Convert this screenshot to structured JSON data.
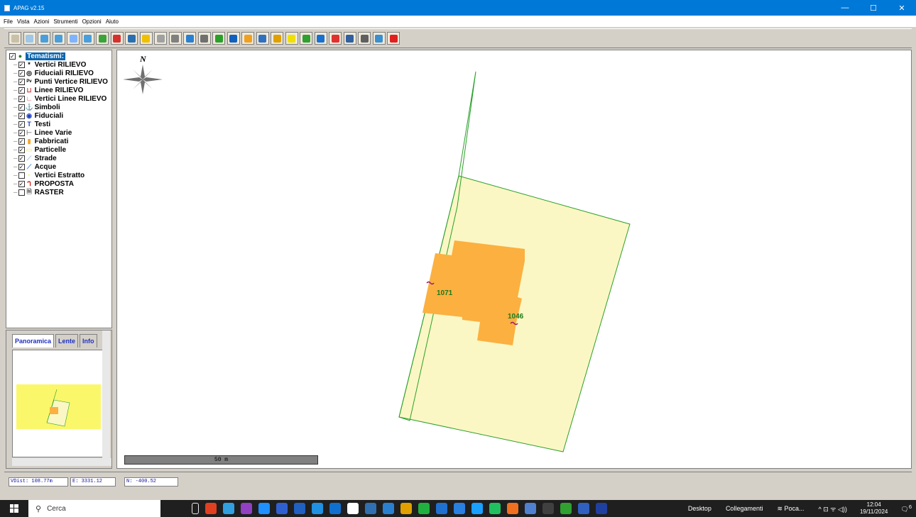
{
  "window": {
    "title": "APAG v2.15",
    "controls": {
      "minimize": "—",
      "maximize": "☐",
      "close": "✕"
    }
  },
  "menu": [
    "File",
    "Vista",
    "Azioni",
    "Strumenti",
    "Opzioni",
    "Aiuto"
  ],
  "toolbar": {
    "icon_colors": [
      "#c8c0a8",
      "#9ec7e8",
      "#4a9edb",
      "#4a9edb",
      "#7fb3ff",
      "#4a9edb",
      "#3aa33a",
      "#d83030",
      "#2a6fb0",
      "#f0c000",
      "#a0a0a0",
      "#808080",
      "#2a80d0",
      "#707070",
      "#2aa02a",
      "#1060c0",
      "#f0a020",
      "#3070c0",
      "#e0a000",
      "#f0e000",
      "#30a030",
      "#1870d0",
      "#e03030",
      "#3060a0",
      "#606060",
      "#3a8fd0",
      "#e02020"
    ]
  },
  "tree": {
    "root": "Tematismi:",
    "layers": [
      {
        "label": "Vertici RILIEVO",
        "checked": true,
        "icon": "*",
        "icon_color": "#000000"
      },
      {
        "label": "Fiduciali RILIEVO",
        "checked": true,
        "icon": "◎",
        "icon_color": "#000000"
      },
      {
        "label": "Punti Vertice RILIEVO",
        "checked": true,
        "icon": "ᴾᵛ",
        "icon_color": "#000000"
      },
      {
        "label": "Linee RILIEVO",
        "checked": true,
        "icon": "⊔",
        "icon_color": "#d04040"
      },
      {
        "label": "Vertici Linee RILIEVO",
        "checked": true,
        "icon": "∟",
        "icon_color": "#d04040"
      },
      {
        "label": "Simboli",
        "checked": true,
        "icon": "⚓",
        "icon_color": "#2040c0"
      },
      {
        "label": "Fiduciali",
        "checked": true,
        "icon": "◉",
        "icon_color": "#2040c0"
      },
      {
        "label": "Testi",
        "checked": true,
        "icon": "T",
        "icon_color": "#2040c0"
      },
      {
        "label": "Linee Varie",
        "checked": true,
        "icon": "⊢",
        "icon_color": "#808080"
      },
      {
        "label": "Fabbricati",
        "checked": true,
        "icon": "▮",
        "icon_color": "#f5a623"
      },
      {
        "label": "Particelle",
        "checked": true,
        "icon": "▭",
        "icon_color": "#f5f08c"
      },
      {
        "label": "Strade",
        "checked": true,
        "icon": "⟋",
        "icon_color": "#9ac0e0"
      },
      {
        "label": "Acque",
        "checked": true,
        "icon": "⟋",
        "icon_color": "#3080e0"
      },
      {
        "label": "Vertici Estratto",
        "checked": false,
        "icon": "·",
        "icon_color": "#f0e000"
      },
      {
        "label": "PROPOSTA",
        "checked": true,
        "icon": "ᒉ",
        "icon_color": "#d02020"
      },
      {
        "label": "RASTER",
        "checked": false,
        "icon": "🗎",
        "icon_color": "#606060"
      }
    ]
  },
  "panel_tabs": [
    "Panoramica",
    "Lente",
    "Info"
  ],
  "map": {
    "north_label": "N",
    "scale_label": "50 m",
    "parcel_labels": [
      "1071",
      "1046"
    ],
    "colors": {
      "parcel_fill": "#fbf7c4",
      "parcel_line": "#2aa02a",
      "building_fill": "#fbb040",
      "label": "#1c7a1c",
      "marker": "#9a1a6a"
    }
  },
  "status": {
    "vdist": "VDist: 108.77m",
    "east": "E: 3331.12",
    "north": "N: -400.52"
  },
  "taskbar": {
    "search_placeholder": "Cerca",
    "desktop": "Desktop",
    "links": "Collegamenti",
    "weather": "Poca...",
    "time": "12:04",
    "date": "19/11/2024",
    "notifications": "6",
    "app_colors": [
      "#e8e8e8",
      "#e04020",
      "#30a0e0",
      "#9040c0",
      "#1e90ff",
      "#3060d0",
      "#2060c0",
      "#2090e0",
      "#1070d0",
      "#ffffff",
      "#3070b0",
      "#2a80d0",
      "#e0a000",
      "#20b040",
      "#2070d0",
      "#2a80e0",
      "#1aa0ff",
      "#20c060",
      "#f07020",
      "#5080d0",
      "#404040",
      "#30a030",
      "#3060c0",
      "#2040a0"
    ]
  }
}
